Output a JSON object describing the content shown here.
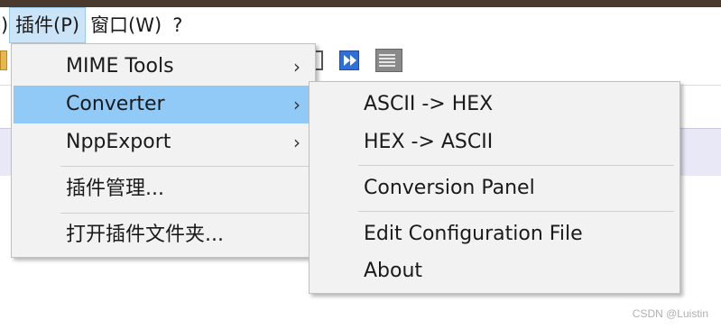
{
  "menubar": {
    "partial": ")",
    "plugins": "插件(P)",
    "window": "窗口(W)",
    "help": "?"
  },
  "plugins_menu": {
    "items": [
      {
        "label": "MIME Tools",
        "arrow": "›"
      },
      {
        "label": "Converter",
        "arrow": "›"
      },
      {
        "label": "NppExport",
        "arrow": "›"
      },
      {
        "label": "插件管理..."
      },
      {
        "label": "打开插件文件夹..."
      }
    ],
    "highlighted": "Converter"
  },
  "converter_submenu": {
    "items": [
      {
        "label": "ASCII -> HEX"
      },
      {
        "label": "HEX -> ASCII"
      },
      {
        "label": "Conversion Panel"
      },
      {
        "label": "Edit Configuration File"
      },
      {
        "label": "About"
      }
    ]
  },
  "toolbar": {
    "icons": [
      "toolbar-icon-partial",
      "toolbar-icon-frame",
      "toolbar-icon-fast-forward",
      "toolbar-icon-panel"
    ]
  },
  "watermark": "CSDN @Luistin",
  "colors": {
    "highlight": "#91c9f7",
    "menu_bg": "#f2f2f2",
    "menubar_active": "#cce4f7",
    "top_strip": "#4a3a2e"
  }
}
